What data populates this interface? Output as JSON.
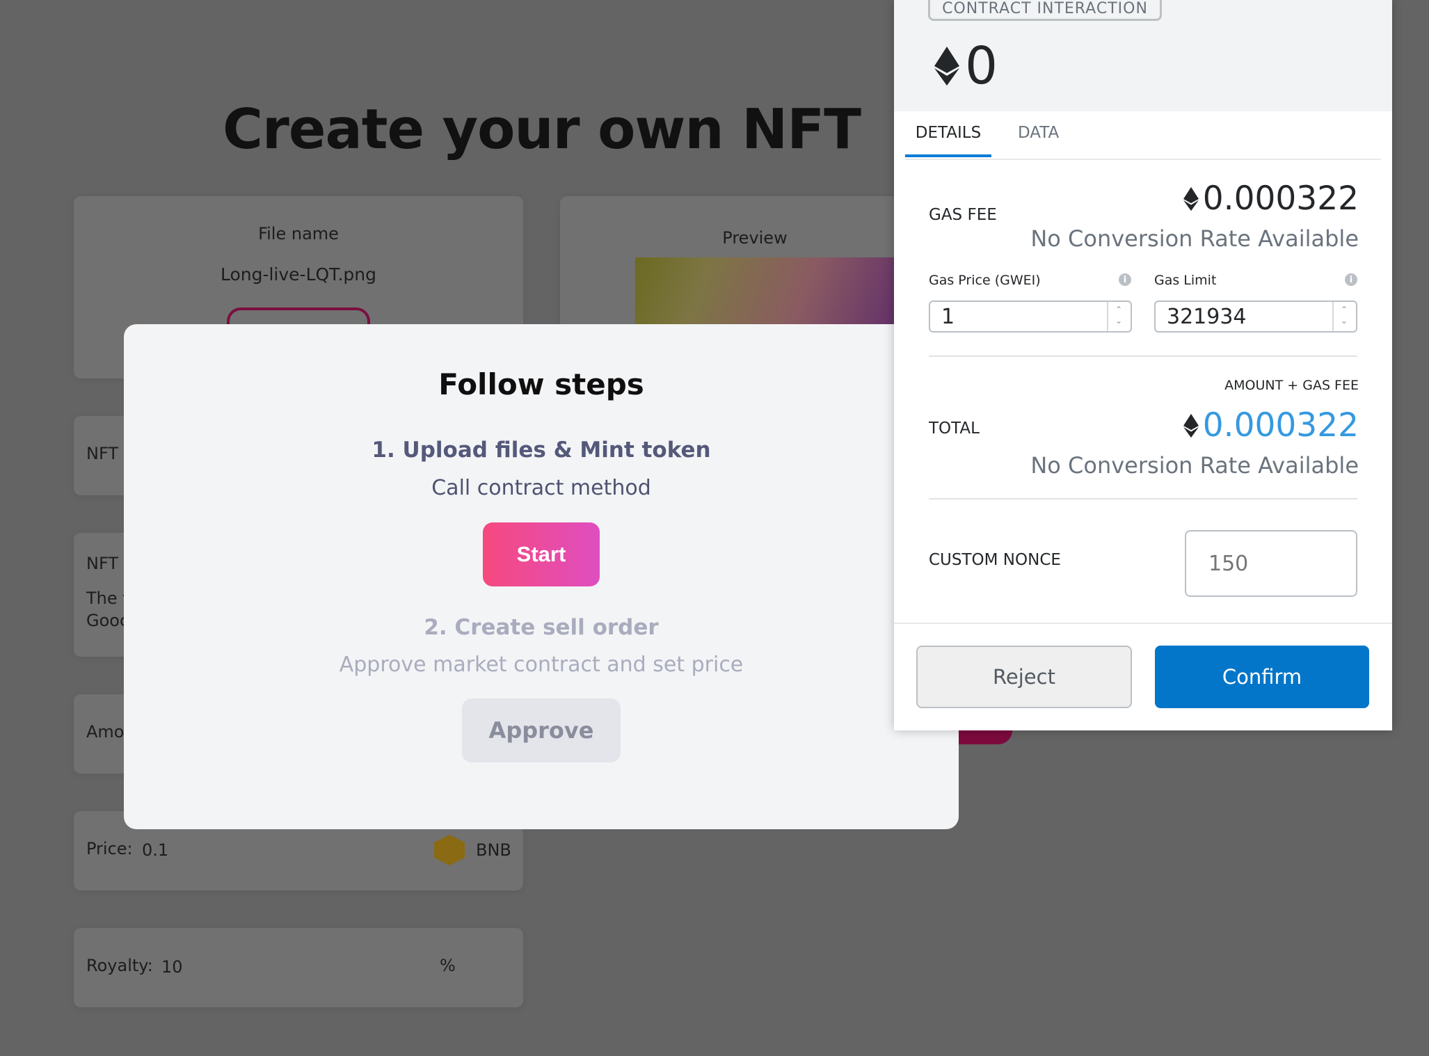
{
  "page": {
    "title": "Create your own NFT"
  },
  "form": {
    "file_name_label": "File name",
    "file_name_value": "Long-live-LQT.png",
    "preview_label": "Preview",
    "nft_label_1": "NFT",
    "nft_label_2": "NFT",
    "desc_line_1": "The f",
    "desc_line_2": "Gooc",
    "amount_label": "Amou",
    "price_label": "Price:",
    "price_value": "0.1",
    "price_currency": "BNB",
    "price_currency_icon": "bnb-icon",
    "royalty_label": "Royalty:",
    "royalty_value": "10",
    "royalty_unit": "%"
  },
  "modal": {
    "title": "Follow steps",
    "step1_title": "1. Upload files & Mint token",
    "step1_subtitle": "Call contract method",
    "step1_button": "Start",
    "step2_title": "2. Create sell order",
    "step2_subtitle": "Approve market contract and set price",
    "step2_button": "Approve"
  },
  "metamask": {
    "badge": "CONTRACT INTERACTION",
    "amount": "0",
    "amount_icon": "eth-icon",
    "tabs": [
      {
        "label": "DETAILS",
        "active": true
      },
      {
        "label": "DATA",
        "active": false
      }
    ],
    "gas_fee_label": "GAS FEE",
    "gas_fee_value": "0.000322",
    "gas_fee_conversion": "No Conversion Rate Available",
    "gas_price_label": "Gas Price (GWEI)",
    "gas_price_value": "1",
    "gas_limit_label": "Gas Limit",
    "gas_limit_value": "321934",
    "amount_gas_label": "AMOUNT + GAS FEE",
    "total_label": "TOTAL",
    "total_value": "0.000322",
    "total_conversion": "No Conversion Rate Available",
    "nonce_label": "CUSTOM NONCE",
    "nonce_placeholder": "150",
    "reject_label": "Reject",
    "confirm_label": "Confirm",
    "colors": {
      "confirm_bg": "#0376c9",
      "total_value": "#3599e0",
      "start_gradient_from": "#f6497e",
      "start_gradient_to": "#df4ec0"
    }
  }
}
